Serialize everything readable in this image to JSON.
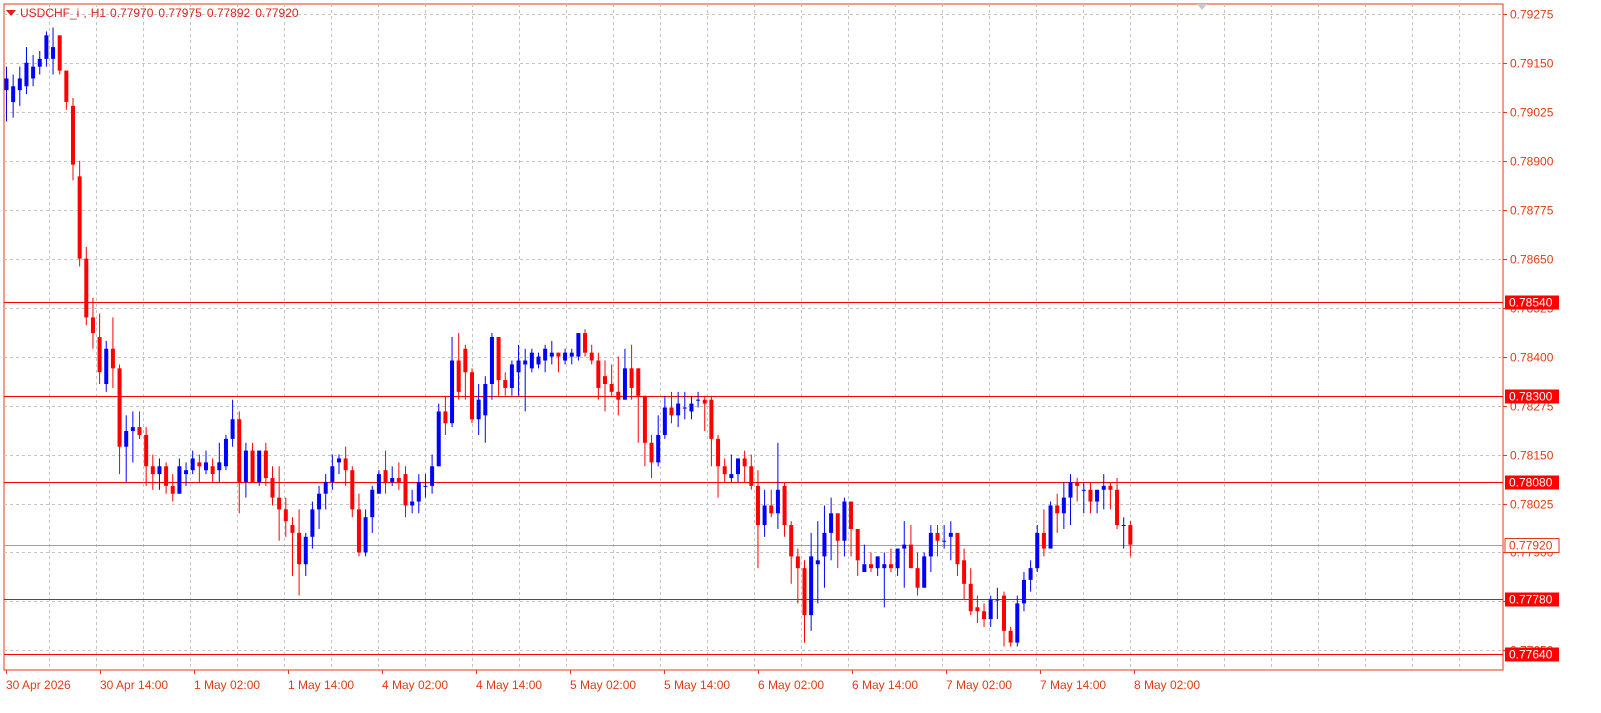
{
  "chart_data": {
    "type": "candlestick",
    "symbol": "USDCHF_i",
    "timeframe": "H1",
    "ohlc_header": {
      "open": "0.77970",
      "high": "0.77975",
      "low": "0.77892",
      "close": "0.77920"
    },
    "y_ticks": [
      "0.79275",
      "0.79150",
      "0.79025",
      "0.78900",
      "0.78775",
      "0.78650",
      "0.78525",
      "0.78400",
      "0.78275",
      "0.78150",
      "0.78025",
      "0.77900",
      "0.77775",
      "0.77650"
    ],
    "ylim": [
      0.776,
      0.793
    ],
    "x_ticks": [
      "30 Apr 2026",
      "30 Apr 14:00",
      "1 May 02:00",
      "1 May 14:00",
      "4 May 02:00",
      "4 May 14:00",
      "5 May 02:00",
      "5 May 14:00",
      "6 May 02:00",
      "6 May 14:00",
      "7 May 02:00",
      "7 May 14:00",
      "8 May 02:00"
    ],
    "grid": true,
    "colors": {
      "bull": "#0000ff",
      "bear": "#ff0000",
      "axis": "#e03c14",
      "grid": "#c4c4c4",
      "level": "#ff0000"
    },
    "levels": [
      {
        "price": 0.7854,
        "label": "0.78540"
      },
      {
        "price": 0.783,
        "label": "0.78300"
      },
      {
        "price": 0.7808,
        "label": "0.78080"
      },
      {
        "price": 0.7778,
        "label": "0.77780"
      },
      {
        "price": 0.7764,
        "label": "0.77640"
      }
    ],
    "current_price": {
      "price": 0.7792,
      "label": "0.77920"
    },
    "candles": [
      [
        0.7908,
        0.7914,
        0.79,
        0.7911
      ],
      [
        0.7905,
        0.7912,
        0.7901,
        0.7909
      ],
      [
        0.7908,
        0.7914,
        0.7904,
        0.7911
      ],
      [
        0.7909,
        0.7919,
        0.7907,
        0.7915
      ],
      [
        0.7911,
        0.7917,
        0.7909,
        0.7914
      ],
      [
        0.7914,
        0.7918,
        0.7912,
        0.7916
      ],
      [
        0.7916,
        0.7923,
        0.7914,
        0.7922
      ],
      [
        0.7916,
        0.7924,
        0.7912,
        0.7919
      ],
      [
        0.7922,
        0.7922,
        0.7912,
        0.7913
      ],
      [
        0.7913,
        0.7913,
        0.7903,
        0.7905
      ],
      [
        0.7904,
        0.7906,
        0.7885,
        0.7889
      ],
      [
        0.7886,
        0.789,
        0.7863,
        0.7865
      ],
      [
        0.7865,
        0.7868,
        0.7848,
        0.785
      ],
      [
        0.785,
        0.7855,
        0.7842,
        0.7846
      ],
      [
        0.7845,
        0.7851,
        0.7833,
        0.7836
      ],
      [
        0.7833,
        0.7844,
        0.7831,
        0.7842
      ],
      [
        0.7842,
        0.785,
        0.7832,
        0.7837
      ],
      [
        0.7837,
        0.7838,
        0.781,
        0.7817
      ],
      [
        0.7817,
        0.7825,
        0.7808,
        0.7821
      ],
      [
        0.7821,
        0.7826,
        0.7813,
        0.7822
      ],
      [
        0.7822,
        0.7826,
        0.7819,
        0.782
      ],
      [
        0.782,
        0.7822,
        0.7807,
        0.7812
      ],
      [
        0.7812,
        0.7815,
        0.7806,
        0.781
      ],
      [
        0.781,
        0.7814,
        0.7806,
        0.7812
      ],
      [
        0.7812,
        0.7813,
        0.7805,
        0.7807
      ],
      [
        0.7807,
        0.781,
        0.7803,
        0.7805
      ],
      [
        0.7805,
        0.7814,
        0.7805,
        0.7812
      ],
      [
        0.781,
        0.7813,
        0.7807,
        0.7811
      ],
      [
        0.7811,
        0.7816,
        0.781,
        0.7814
      ],
      [
        0.7813,
        0.7815,
        0.7808,
        0.7812
      ],
      [
        0.7811,
        0.7816,
        0.781,
        0.7813
      ],
      [
        0.7812,
        0.7814,
        0.7808,
        0.781
      ],
      [
        0.7811,
        0.7818,
        0.7808,
        0.7813
      ],
      [
        0.7812,
        0.782,
        0.7811,
        0.7819
      ],
      [
        0.7819,
        0.7829,
        0.7817,
        0.7824
      ],
      [
        0.7824,
        0.7826,
        0.78,
        0.7808
      ],
      [
        0.7808,
        0.7818,
        0.7804,
        0.7816
      ],
      [
        0.7816,
        0.7818,
        0.7808,
        0.7808
      ],
      [
        0.7808,
        0.7816,
        0.7807,
        0.7816
      ],
      [
        0.7816,
        0.7818,
        0.7807,
        0.7809
      ],
      [
        0.7809,
        0.7812,
        0.7802,
        0.7804
      ],
      [
        0.7804,
        0.7812,
        0.7793,
        0.7801
      ],
      [
        0.7801,
        0.7804,
        0.7794,
        0.7798
      ],
      [
        0.7797,
        0.7799,
        0.7784,
        0.7795
      ],
      [
        0.7795,
        0.7801,
        0.7779,
        0.7787
      ],
      [
        0.7787,
        0.7795,
        0.7784,
        0.7794
      ],
      [
        0.7794,
        0.7803,
        0.7791,
        0.7801
      ],
      [
        0.7801,
        0.7807,
        0.7796,
        0.7805
      ],
      [
        0.7805,
        0.781,
        0.7801,
        0.7808
      ],
      [
        0.7808,
        0.7815,
        0.7806,
        0.7812
      ],
      [
        0.7813,
        0.7815,
        0.781,
        0.7814
      ],
      [
        0.7814,
        0.7817,
        0.7807,
        0.7811
      ],
      [
        0.7811,
        0.7812,
        0.7799,
        0.7801
      ],
      [
        0.7801,
        0.7805,
        0.7789,
        0.779
      ],
      [
        0.779,
        0.7801,
        0.7789,
        0.7799
      ],
      [
        0.7799,
        0.7807,
        0.7795,
        0.7806
      ],
      [
        0.7805,
        0.7811,
        0.7805,
        0.781
      ],
      [
        0.7811,
        0.7816,
        0.7805,
        0.7808
      ],
      [
        0.7808,
        0.7812,
        0.7807,
        0.7809
      ],
      [
        0.7809,
        0.7813,
        0.7806,
        0.7808
      ],
      [
        0.781,
        0.7812,
        0.7799,
        0.7802
      ],
      [
        0.7802,
        0.7806,
        0.78,
        0.7803
      ],
      [
        0.7803,
        0.781,
        0.78,
        0.7808
      ],
      [
        0.7807,
        0.781,
        0.7804,
        0.7807
      ],
      [
        0.7807,
        0.7815,
        0.7805,
        0.7812
      ],
      [
        0.7812,
        0.7828,
        0.7812,
        0.7826
      ],
      [
        0.7826,
        0.783,
        0.782,
        0.7823
      ],
      [
        0.7823,
        0.7845,
        0.7822,
        0.7839
      ],
      [
        0.7839,
        0.7846,
        0.7829,
        0.7831
      ],
      [
        0.7842,
        0.7843,
        0.7829,
        0.7836
      ],
      [
        0.7836,
        0.7837,
        0.7823,
        0.7824
      ],
      [
        0.7824,
        0.7833,
        0.782,
        0.7829
      ],
      [
        0.7825,
        0.7835,
        0.7818,
        0.7833
      ],
      [
        0.7833,
        0.7846,
        0.7829,
        0.7845
      ],
      [
        0.7845,
        0.7845,
        0.783,
        0.7834
      ],
      [
        0.7834,
        0.7836,
        0.783,
        0.7832
      ],
      [
        0.7832,
        0.7839,
        0.783,
        0.7838
      ],
      [
        0.7836,
        0.7843,
        0.783,
        0.7839
      ],
      [
        0.7838,
        0.7842,
        0.7826,
        0.7839
      ],
      [
        0.7837,
        0.7842,
        0.7836,
        0.7841
      ],
      [
        0.7838,
        0.7841,
        0.7837,
        0.784
      ],
      [
        0.7839,
        0.7843,
        0.7836,
        0.7842
      ],
      [
        0.784,
        0.7844,
        0.7838,
        0.7841
      ],
      [
        0.7841,
        0.7841,
        0.7836,
        0.784
      ],
      [
        0.7839,
        0.7842,
        0.7838,
        0.7841
      ],
      [
        0.784,
        0.7842,
        0.7838,
        0.7841
      ],
      [
        0.784,
        0.7846,
        0.7839,
        0.7846
      ],
      [
        0.7846,
        0.7847,
        0.784,
        0.7841
      ],
      [
        0.7841,
        0.7843,
        0.7838,
        0.7839
      ],
      [
        0.7839,
        0.7841,
        0.7829,
        0.7832
      ],
      [
        0.7835,
        0.7839,
        0.7826,
        0.7833
      ],
      [
        0.7833,
        0.7838,
        0.783,
        0.7831
      ],
      [
        0.7831,
        0.784,
        0.7825,
        0.7829
      ],
      [
        0.7829,
        0.7842,
        0.7829,
        0.7837
      ],
      [
        0.7837,
        0.7843,
        0.7829,
        0.7832
      ],
      [
        0.7837,
        0.7837,
        0.7818,
        0.783
      ],
      [
        0.783,
        0.783,
        0.7812,
        0.7818
      ],
      [
        0.7818,
        0.782,
        0.7809,
        0.7813
      ],
      [
        0.7813,
        0.7825,
        0.7812,
        0.782
      ],
      [
        0.782,
        0.783,
        0.7819,
        0.7827
      ],
      [
        0.7827,
        0.7831,
        0.7823,
        0.7825
      ],
      [
        0.7825,
        0.7831,
        0.7822,
        0.7828
      ],
      [
        0.7827,
        0.7831,
        0.7824,
        0.7827
      ],
      [
        0.7826,
        0.783,
        0.7824,
        0.7828
      ],
      [
        0.7829,
        0.7831,
        0.7827,
        0.7829
      ],
      [
        0.7829,
        0.783,
        0.7821,
        0.7828
      ],
      [
        0.7829,
        0.783,
        0.7812,
        0.7819
      ],
      [
        0.7819,
        0.782,
        0.7804,
        0.7812
      ],
      [
        0.7812,
        0.7814,
        0.7808,
        0.781
      ],
      [
        0.7809,
        0.7815,
        0.7808,
        0.781
      ],
      [
        0.781,
        0.7814,
        0.7808,
        0.7814
      ],
      [
        0.7814,
        0.7816,
        0.7808,
        0.7812
      ],
      [
        0.7812,
        0.7815,
        0.7806,
        0.7807
      ],
      [
        0.7807,
        0.7811,
        0.7786,
        0.7797
      ],
      [
        0.7797,
        0.7806,
        0.7794,
        0.7802
      ],
      [
        0.7802,
        0.7806,
        0.7799,
        0.78
      ],
      [
        0.78,
        0.7818,
        0.7796,
        0.7806
      ],
      [
        0.7807,
        0.7808,
        0.7794,
        0.7797
      ],
      [
        0.7797,
        0.7798,
        0.7782,
        0.7789
      ],
      [
        0.7789,
        0.7791,
        0.7777,
        0.7786
      ],
      [
        0.7786,
        0.7788,
        0.7767,
        0.7774
      ],
      [
        0.7774,
        0.7795,
        0.777,
        0.7789
      ],
      [
        0.7787,
        0.7798,
        0.7777,
        0.7788
      ],
      [
        0.7789,
        0.7802,
        0.7781,
        0.7795
      ],
      [
        0.7795,
        0.7804,
        0.7788,
        0.78
      ],
      [
        0.78,
        0.78,
        0.7786,
        0.7793
      ],
      [
        0.7793,
        0.7804,
        0.7789,
        0.7803
      ],
      [
        0.7803,
        0.7803,
        0.7789,
        0.7796
      ],
      [
        0.7796,
        0.7796,
        0.7784,
        0.7788
      ],
      [
        0.7785,
        0.7792,
        0.7787,
        0.7787
      ],
      [
        0.7787,
        0.779,
        0.7785,
        0.7786
      ],
      [
        0.7786,
        0.7789,
        0.7784,
        0.7789
      ],
      [
        0.7786,
        0.779,
        0.7776,
        0.7787
      ],
      [
        0.7787,
        0.7791,
        0.7785,
        0.7786
      ],
      [
        0.7786,
        0.7791,
        0.7784,
        0.7791
      ],
      [
        0.7791,
        0.7798,
        0.7781,
        0.7792
      ],
      [
        0.7792,
        0.7797,
        0.7786,
        0.7786
      ],
      [
        0.7786,
        0.779,
        0.7779,
        0.7781
      ],
      [
        0.7781,
        0.779,
        0.7781,
        0.7789
      ],
      [
        0.7789,
        0.7797,
        0.7785,
        0.7795
      ],
      [
        0.7795,
        0.7797,
        0.7789,
        0.7793
      ],
      [
        0.7793,
        0.7797,
        0.7791,
        0.7793
      ],
      [
        0.7794,
        0.7798,
        0.7788,
        0.7795
      ],
      [
        0.7795,
        0.7795,
        0.7784,
        0.7787
      ],
      [
        0.7788,
        0.7791,
        0.7778,
        0.7782
      ],
      [
        0.7782,
        0.7786,
        0.7774,
        0.7775
      ],
      [
        0.7776,
        0.7779,
        0.7772,
        0.7775
      ],
      [
        0.7775,
        0.7777,
        0.7771,
        0.7773
      ],
      [
        0.7773,
        0.7779,
        0.7771,
        0.7778
      ],
      [
        0.7778,
        0.7781,
        0.7773,
        0.7778
      ],
      [
        0.7779,
        0.778,
        0.7766,
        0.777
      ],
      [
        0.777,
        0.7771,
        0.7766,
        0.7767
      ],
      [
        0.7767,
        0.7779,
        0.7766,
        0.7777
      ],
      [
        0.7777,
        0.7785,
        0.7775,
        0.7783
      ],
      [
        0.7783,
        0.7788,
        0.778,
        0.7786
      ],
      [
        0.7786,
        0.7797,
        0.7785,
        0.7795
      ],
      [
        0.7795,
        0.7801,
        0.7789,
        0.7791
      ],
      [
        0.7791,
        0.7803,
        0.7791,
        0.7802
      ],
      [
        0.7802,
        0.7805,
        0.7795,
        0.78
      ],
      [
        0.78,
        0.7808,
        0.7796,
        0.7804
      ],
      [
        0.7804,
        0.781,
        0.7797,
        0.7808
      ],
      [
        0.7808,
        0.7809,
        0.7803,
        0.7807
      ],
      [
        0.7806,
        0.7808,
        0.78,
        0.7806
      ],
      [
        0.7806,
        0.7808,
        0.78,
        0.7803
      ],
      [
        0.7803,
        0.7806,
        0.78,
        0.7806
      ],
      [
        0.7806,
        0.781,
        0.7801,
        0.7807
      ],
      [
        0.7807,
        0.7808,
        0.7801,
        0.7806
      ],
      [
        0.7806,
        0.7809,
        0.7796,
        0.7797
      ],
      [
        0.7797,
        0.7799,
        0.7791,
        0.7797
      ],
      [
        0.7797,
        0.7798,
        0.7789,
        0.7792
      ]
    ]
  }
}
